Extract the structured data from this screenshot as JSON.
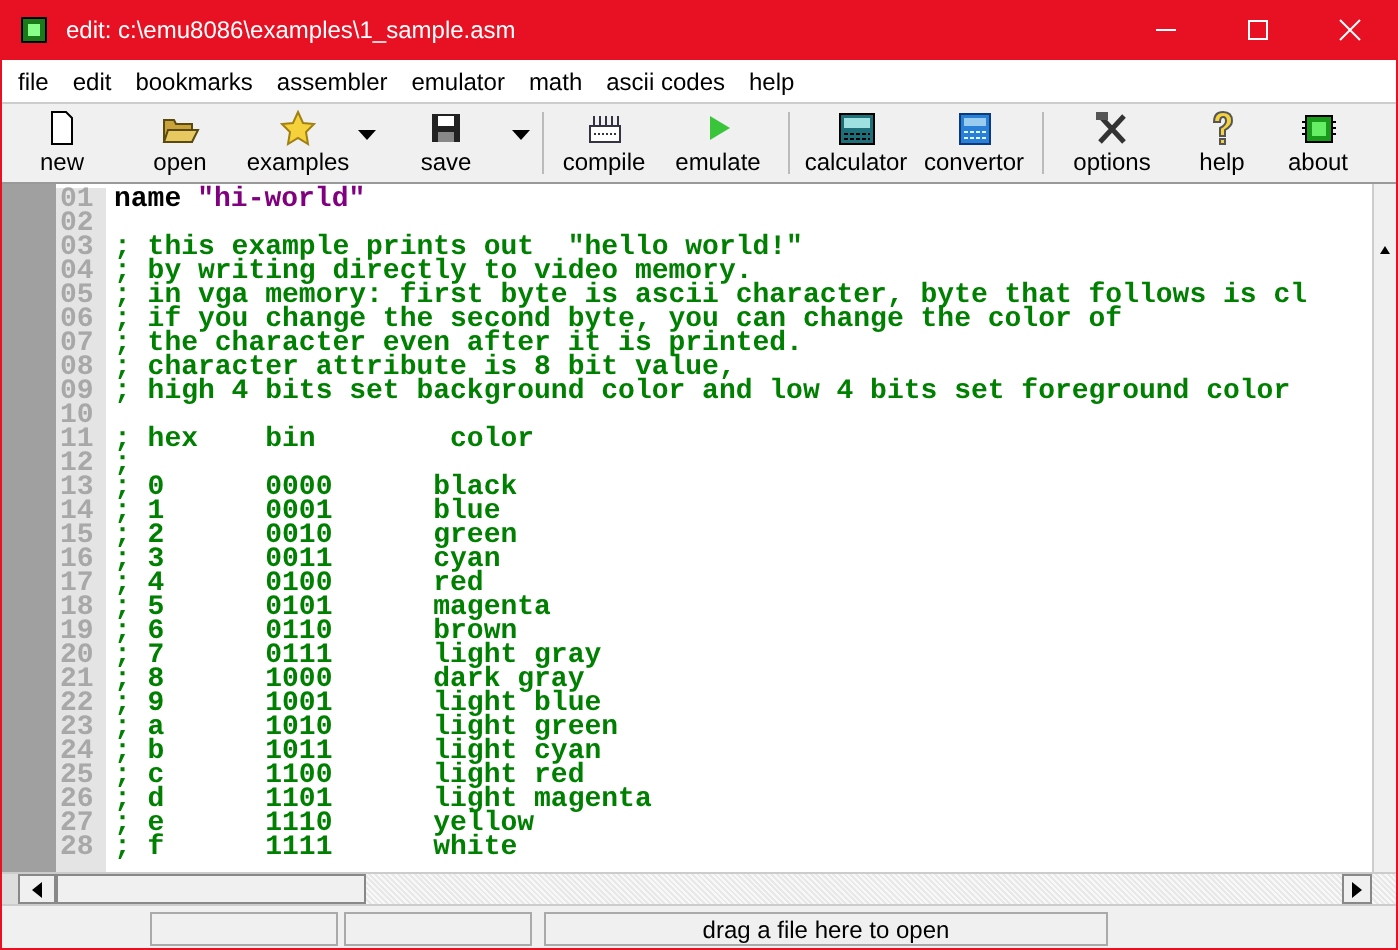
{
  "window": {
    "title": "edit: c:\\emu8086\\examples\\1_sample.asm"
  },
  "menu": [
    "file",
    "edit",
    "bookmarks",
    "assembler",
    "emulator",
    "math",
    "ascii codes",
    "help"
  ],
  "toolbar": [
    {
      "label": "new",
      "kind": "new",
      "dropdown": false
    },
    {
      "label": "open",
      "kind": "open",
      "dropdown": false
    },
    {
      "label": "examples",
      "kind": "examples",
      "dropdown": true
    },
    {
      "label": "save",
      "kind": "save",
      "dropdown": true,
      "separator_after": true
    },
    {
      "label": "compile",
      "kind": "compile",
      "dropdown": false
    },
    {
      "label": "emulate",
      "kind": "emulate",
      "dropdown": false,
      "separator_after": true
    },
    {
      "label": "calculator",
      "kind": "calculator",
      "dropdown": false
    },
    {
      "label": "convertor",
      "kind": "convertor",
      "dropdown": false,
      "separator_after": true
    },
    {
      "label": "options",
      "kind": "options",
      "dropdown": false
    },
    {
      "label": "help",
      "kind": "help",
      "dropdown": false
    },
    {
      "label": "about",
      "kind": "about",
      "dropdown": false
    }
  ],
  "editor": {
    "lines": [
      {
        "number": "01",
        "kind": "directive",
        "keyword": "name",
        "argument": "\"hi-world\""
      },
      {
        "number": "02",
        "kind": "blank"
      },
      {
        "number": "03",
        "kind": "comment",
        "text": "; this example prints out  \"hello world!\""
      },
      {
        "number": "04",
        "kind": "comment",
        "text": "; by writing directly to video memory."
      },
      {
        "number": "05",
        "kind": "comment",
        "text": "; in vga memory: first byte is ascii character, byte that follows is cl"
      },
      {
        "number": "06",
        "kind": "comment",
        "text": "; if you change the second byte, you can change the color of"
      },
      {
        "number": "07",
        "kind": "comment",
        "text": "; the character even after it is printed."
      },
      {
        "number": "08",
        "kind": "comment",
        "text": "; character attribute is 8 bit value,"
      },
      {
        "number": "09",
        "kind": "comment",
        "text": "; high 4 bits set background color and low 4 bits set foreground color"
      },
      {
        "number": "10",
        "kind": "blank"
      },
      {
        "number": "11",
        "kind": "comment",
        "text": "; hex    bin        color"
      },
      {
        "number": "12",
        "kind": "comment",
        "text": ";"
      },
      {
        "number": "13",
        "kind": "comment",
        "text": "; 0      0000      black"
      },
      {
        "number": "14",
        "kind": "comment",
        "text": "; 1      0001      blue"
      },
      {
        "number": "15",
        "kind": "comment",
        "text": "; 2      0010      green"
      },
      {
        "number": "16",
        "kind": "comment",
        "text": "; 3      0011      cyan"
      },
      {
        "number": "17",
        "kind": "comment",
        "text": "; 4      0100      red"
      },
      {
        "number": "18",
        "kind": "comment",
        "text": "; 5      0101      magenta"
      },
      {
        "number": "19",
        "kind": "comment",
        "text": "; 6      0110      brown"
      },
      {
        "number": "20",
        "kind": "comment",
        "text": "; 7      0111      light gray"
      },
      {
        "number": "21",
        "kind": "comment",
        "text": "; 8      1000      dark gray"
      },
      {
        "number": "22",
        "kind": "comment",
        "text": "; 9      1001      light blue"
      },
      {
        "number": "23",
        "kind": "comment",
        "text": "; a      1010      light green"
      },
      {
        "number": "24",
        "kind": "comment",
        "text": "; b      1011      light cyan"
      },
      {
        "number": "25",
        "kind": "comment",
        "text": "; c      1100      light red"
      },
      {
        "number": "26",
        "kind": "comment",
        "text": "; d      1101      light magenta"
      },
      {
        "number": "27",
        "kind": "comment",
        "text": "; e      1110      yellow"
      },
      {
        "number": "28",
        "kind": "comment",
        "text": "; f      1111      white"
      }
    ]
  },
  "status_bar": {
    "message": "drag a file here to open"
  }
}
